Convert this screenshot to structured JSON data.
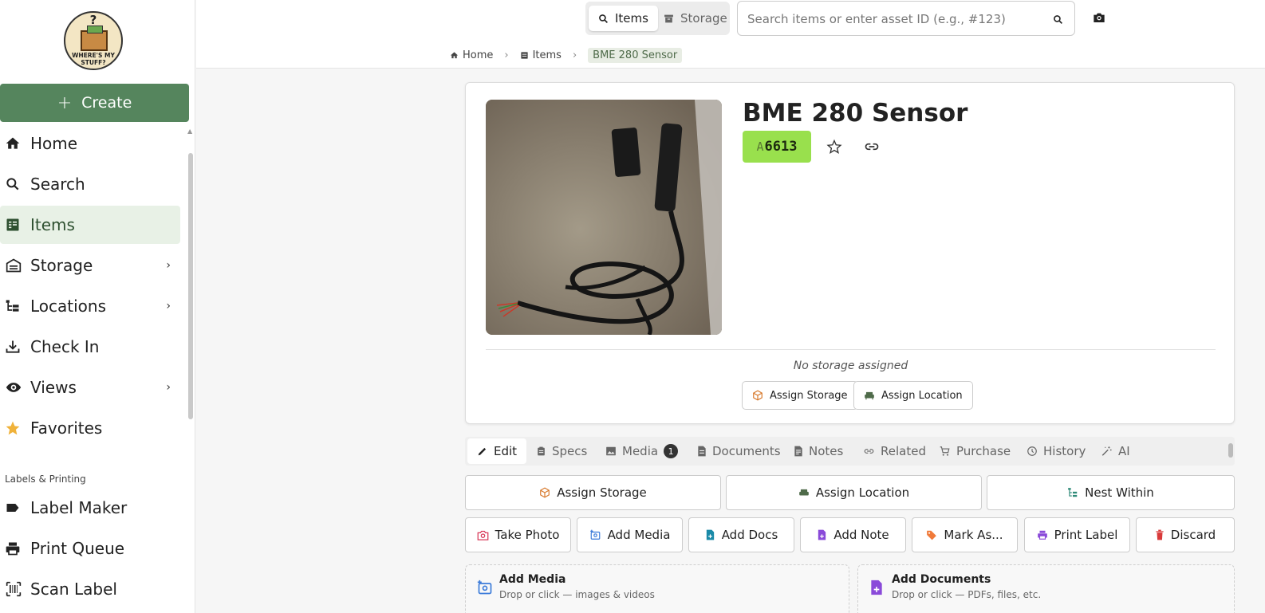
{
  "sidebar": {
    "logo": {
      "q": "?",
      "text": "WHERE'S MY STUFF?"
    },
    "create_label": "Create",
    "items": [
      {
        "label": "Home",
        "icon": "home-icon"
      },
      {
        "label": "Search",
        "icon": "search-icon"
      },
      {
        "label": "Items",
        "icon": "items-icon",
        "active": true
      },
      {
        "label": "Storage",
        "icon": "storage-icon",
        "expandable": true
      },
      {
        "label": "Locations",
        "icon": "locations-icon",
        "expandable": true
      },
      {
        "label": "Check In",
        "icon": "download-icon"
      },
      {
        "label": "Views",
        "icon": "eye-icon",
        "expandable": true
      },
      {
        "label": "Favorites",
        "icon": "star-icon"
      }
    ],
    "section_label": "Labels & Printing",
    "printing_items": [
      {
        "label": "Label Maker",
        "icon": "label-icon"
      },
      {
        "label": "Print Queue",
        "icon": "printer-icon"
      },
      {
        "label": "Scan Label",
        "icon": "barcode-icon"
      }
    ]
  },
  "topbar": {
    "segment": {
      "items_label": "Items",
      "storage_label": "Storage"
    },
    "search_placeholder": "Search items or enter asset ID (e.g., #123)"
  },
  "breadcrumb": {
    "home": "Home",
    "items": "Items",
    "current": "BME 280 Sensor"
  },
  "item": {
    "title": "BME 280 Sensor",
    "asset_prefix": "A",
    "asset_id": "6613",
    "no_storage": "No storage assigned",
    "assign_storage": "Assign Storage",
    "assign_location": "Assign Location"
  },
  "tabs": [
    {
      "label": "Edit",
      "active": true
    },
    {
      "label": "Specs"
    },
    {
      "label": "Media",
      "badge": "1"
    },
    {
      "label": "Documents"
    },
    {
      "label": "Notes"
    },
    {
      "label": "Related"
    },
    {
      "label": "Purchase"
    },
    {
      "label": "History"
    },
    {
      "label": "AI"
    }
  ],
  "actions_row1": [
    "Assign Storage",
    "Assign Location",
    "Nest Within"
  ],
  "actions_row2": [
    "Take Photo",
    "Add Media",
    "Add Docs",
    "Add Note",
    "Mark As...",
    "Print Label",
    "Discard"
  ],
  "drop_zones": [
    {
      "title": "Add Media",
      "subtitle": "Drop or click — images & videos"
    },
    {
      "title": "Add Documents",
      "subtitle": "Drop or click — PDFs, files, etc."
    }
  ],
  "colors": {
    "brand_green": "#55855d",
    "asset_badge": "#99e04d",
    "discard_red": "#d93a3a"
  }
}
